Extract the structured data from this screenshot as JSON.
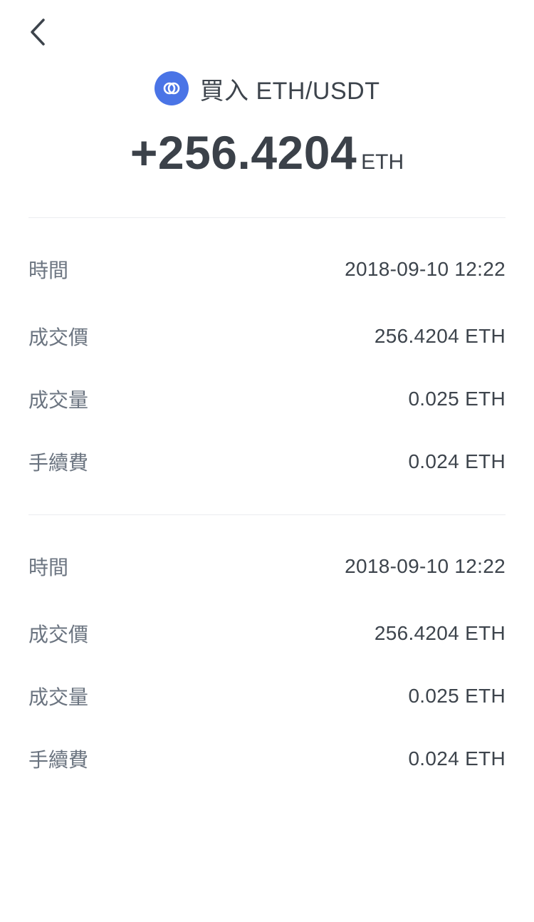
{
  "header": {
    "title": "買入 ETH/USDT",
    "icon": "link-rings-icon",
    "icon_color": "#4a74e6"
  },
  "amount": {
    "value": "+256.4204",
    "unit": "ETH"
  },
  "colors": {
    "divider": "#ebedf0",
    "back_icon": "#3d444c"
  },
  "records": [
    {
      "rows": [
        {
          "label": "時間",
          "value": "2018-09-10 12:22"
        },
        {
          "label": "成交價",
          "value": "256.4204 ETH"
        },
        {
          "label": "成交量",
          "value": "0.025 ETH"
        },
        {
          "label": "手續費",
          "value": "0.024 ETH"
        }
      ]
    },
    {
      "rows": [
        {
          "label": "時間",
          "value": "2018-09-10 12:22"
        },
        {
          "label": "成交價",
          "value": "256.4204 ETH"
        },
        {
          "label": "成交量",
          "value": "0.025 ETH"
        },
        {
          "label": "手續費",
          "value": "0.024 ETH"
        }
      ]
    }
  ]
}
